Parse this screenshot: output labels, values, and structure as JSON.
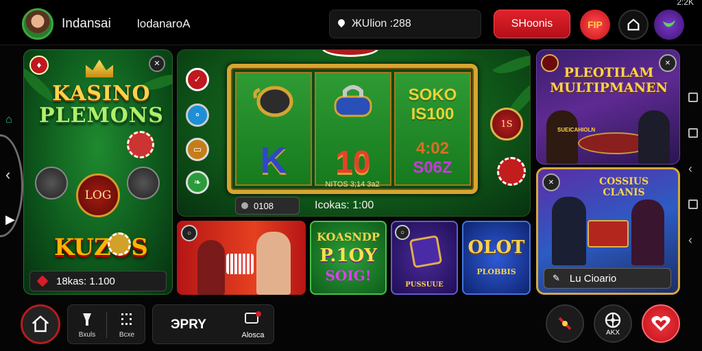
{
  "header": {
    "username": "Indansai",
    "currency_label": "lodanaroA",
    "clock": "2:2K",
    "search": {
      "value": "ЖUlion :288"
    },
    "red_button_label": "SHoonis",
    "gift_label": "FIP"
  },
  "left_panel": {
    "title_line1": "KASINO",
    "title_line2": "PLEMONS",
    "coin_label": "LOG",
    "brand": "KUZOS",
    "balance": "18kas: 1.100"
  },
  "main_game": {
    "reel3_line1": "SOKO",
    "reel3_line2": "IS100",
    "reel3_line3": "4:02",
    "reel3_line4": "S06Z",
    "reel1_letter": "K",
    "reel2_number": "10",
    "reel_caption": "NITOS  3;14 3a2",
    "side_chip": "1S",
    "pill_value": "0108",
    "timer": "Icokas: 1:00"
  },
  "top_right": {
    "title_line1": "PLEOTILAM",
    "title_line2": "MULTIPMANEN",
    "sign": "SUEICAHIOLN"
  },
  "bottom_right": {
    "title_line1": "COSSIUS",
    "title_line2": "CLANIS",
    "label": "Lu Cioario"
  },
  "tiles": {
    "t2_line1": "KOASNDP",
    "t2_line2": "P.1OY",
    "t2_line3": "SOIG!",
    "t3_caption": "PUSSUUE",
    "t4_line1": "OLOT",
    "t4_line2": "PLOBBIS"
  },
  "bottom_nav": {
    "btn1_label": "Bxuls",
    "btn2_label": "Bcxe",
    "pay_label": "ЭPRY",
    "alert_label": "Alosca",
    "right_label": "AKX"
  },
  "colors": {
    "accent_red": "#d61d29",
    "gold": "#ffd24a",
    "green": "#1c7f25"
  }
}
